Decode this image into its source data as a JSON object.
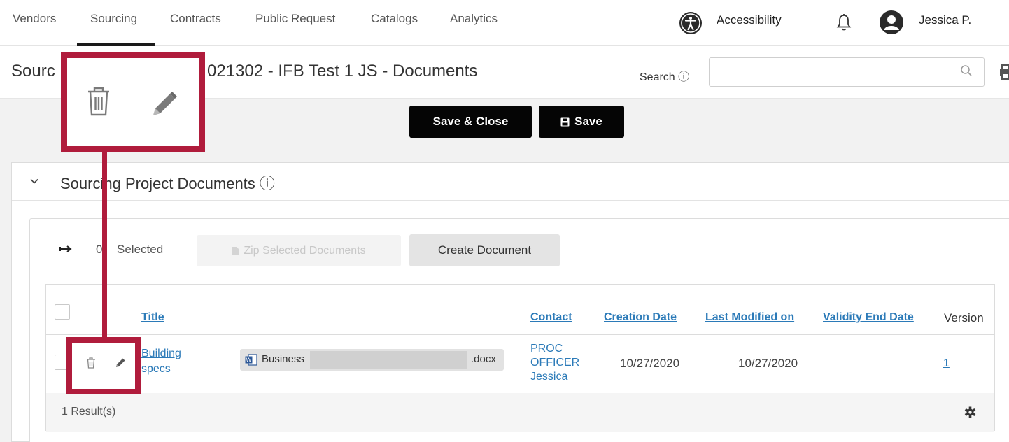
{
  "nav": {
    "items": [
      "Vendors",
      "Sourcing",
      "Contracts",
      "Public Request",
      "Catalogs",
      "Analytics"
    ],
    "active": "Sourcing",
    "accessibility_label": "Accessibility",
    "user_name": "Jessica P."
  },
  "header": {
    "title_left": "Sourc",
    "title_right": "021302 - IFB Test 1 JS - Documents",
    "search_label": "Search ⓘ",
    "search_value": ""
  },
  "actions": {
    "save_close_label": "Save & Close",
    "save_label": "Save"
  },
  "section": {
    "title": "Sourcing Project Documents ⓘ"
  },
  "selection": {
    "count": "0",
    "label": "Selected",
    "zip_label": "Zip Selected Documents",
    "create_label": "Create Document"
  },
  "table": {
    "columns": {
      "title": "Title",
      "contact": "Contact",
      "creation_date": "Creation Date",
      "last_modified": "Last Modified on",
      "validity_end": "Validity End Date",
      "version": "Version"
    },
    "rows": [
      {
        "title_line1": "Building",
        "title_line2": "specs",
        "file_name": "Business",
        "file_ext": ".docx",
        "contact_line1": "PROC",
        "contact_line2": "OFFICER",
        "contact_line3": "Jessica",
        "creation_date": "10/27/2020",
        "last_modified": "10/27/2020",
        "validity_end": "",
        "version": "1"
      }
    ],
    "results": "1 Result(s)"
  },
  "colors": {
    "link": "#2b7ab8",
    "callout": "#b01c3c",
    "primary_button": "#050505"
  }
}
